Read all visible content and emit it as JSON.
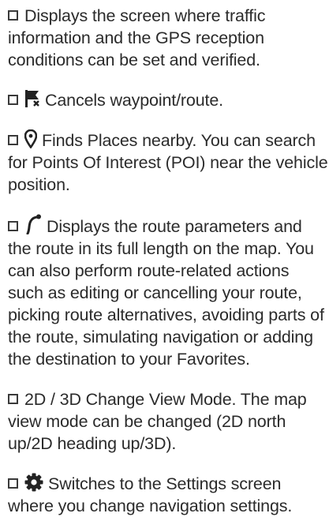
{
  "items": [
    {
      "icon": "none",
      "text": "Displays the screen where traffic information and the GPS reception conditions can be set and verified."
    },
    {
      "icon": "waypoint-flag-cancel-icon",
      "text": "Cancels waypoint/route."
    },
    {
      "icon": "map-pin-icon",
      "text": "Finds Places nearby. You can search for Points Of Interest (POI) near the vehicle position."
    },
    {
      "icon": "route-path-icon",
      "text": "Displays the route parameters and the route in its full length on the map. You can also perform route-related actions such as editing or cancelling your route, picking route alternatives, avoiding parts of the route, simulating navigation or adding the destination to your Favorites."
    },
    {
      "icon": "none",
      "text": "2D / 3D Change View Mode. The map view mode can be changed (2D north up/2D heading up/3D)."
    },
    {
      "icon": "settings-gear-icon",
      "text": "Switches to the Settings screen where you change navigation settings."
    }
  ]
}
